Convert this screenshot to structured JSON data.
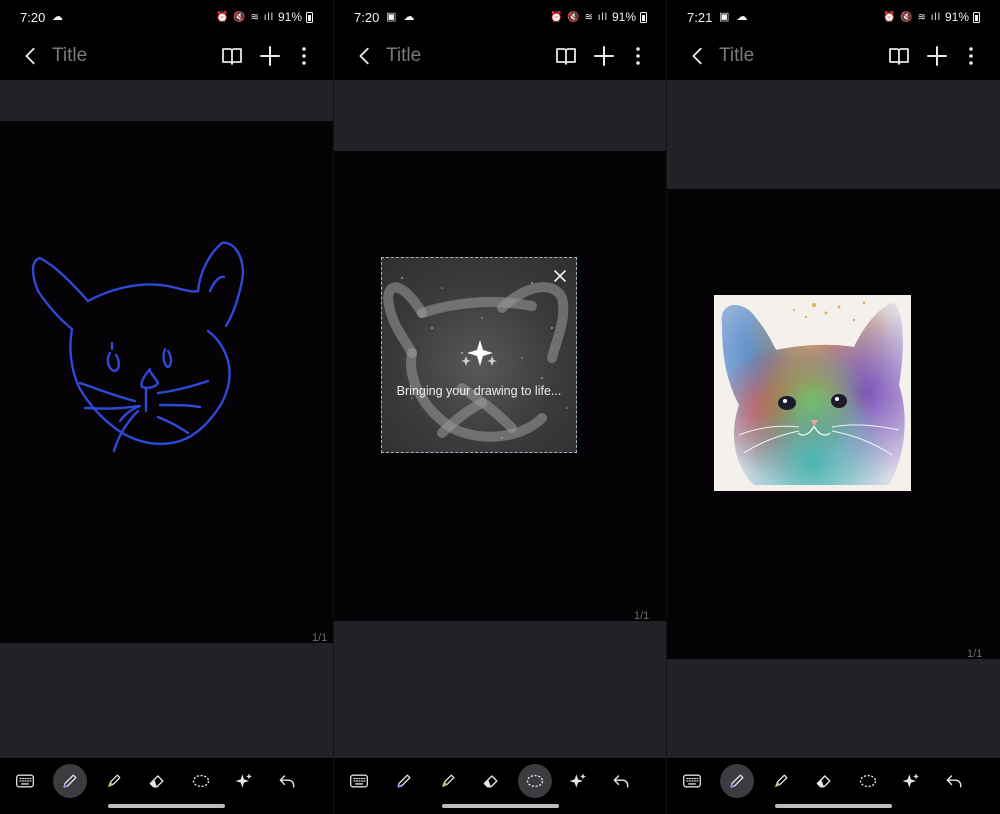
{
  "screens": [
    {
      "status": {
        "time": "7:20",
        "battery": "91%"
      },
      "header": {
        "title": "Title"
      },
      "page_number": "1/1",
      "toolbar_selected": "pen"
    },
    {
      "status": {
        "time": "7:20",
        "battery": "91%"
      },
      "header": {
        "title": "Title"
      },
      "page_number": "1/1",
      "loading_text": "Bringing your drawing to life...",
      "toolbar_selected": "lasso"
    },
    {
      "status": {
        "time": "7:21",
        "battery": "91%"
      },
      "header": {
        "title": "Title"
      },
      "page_number": "1/1",
      "toolbar_selected": "pen"
    }
  ],
  "toolbar_items": [
    "keyboard-icon",
    "pen-icon",
    "highlighter-icon",
    "eraser-icon",
    "lasso-icon",
    "ai-sparkle-icon",
    "undo-icon"
  ],
  "colors": {
    "background": "#000000",
    "canvas_margin": "#232125",
    "sketch_stroke": "#2f49d6",
    "selected_tool": "#3c3b40"
  }
}
